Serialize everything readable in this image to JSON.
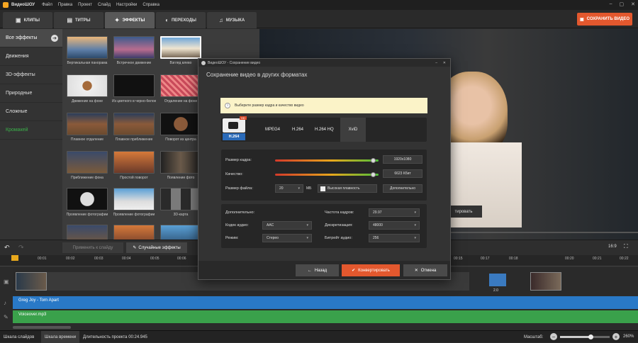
{
  "app": {
    "name": "ВидеоШОУ",
    "menu": [
      "Файл",
      "Правка",
      "Проект",
      "Слайд",
      "Настройки",
      "Справка"
    ]
  },
  "tabs": [
    {
      "label": "КЛИПЫ",
      "icon": "clips-icon"
    },
    {
      "label": "ТИТРЫ",
      "icon": "titles-icon"
    },
    {
      "label": "ЭФФЕКТЫ",
      "icon": "effects-icon"
    },
    {
      "label": "ПЕРЕХОДЫ",
      "icon": "transitions-icon"
    },
    {
      "label": "МУЗЫКА",
      "icon": "music-icon"
    }
  ],
  "save_video_label": "СОХРАНИТЬ ВИДЕО",
  "sidebar": {
    "items": [
      "Все эффекты",
      "Движения",
      "3D-эффекты",
      "Природные",
      "Сложные",
      "Кромакей"
    ]
  },
  "effects": [
    {
      "label": "Вертикальная панорама"
    },
    {
      "label": "Встречное движение"
    },
    {
      "label": "Взгляд влево"
    },
    {
      "label": "Движение на фоне"
    },
    {
      "label": "Из цветного в черно-белое"
    },
    {
      "label": "Отдаление на фоне"
    },
    {
      "label": "Плавное отдаление"
    },
    {
      "label": "Плавное приближение"
    },
    {
      "label": "Поворот из центра"
    },
    {
      "label": "Приближение фона"
    },
    {
      "label": "Простой поворот"
    },
    {
      "label": "Появление фото"
    },
    {
      "label": "Проявление фотографии"
    },
    {
      "label": "Проявление фотографии"
    },
    {
      "label": "3D-карта"
    }
  ],
  "preview": {
    "overlay_button": "тировать",
    "aspect": "16:9"
  },
  "toolbar": {
    "apply_label": "Применить к слайду",
    "random_label": "Случайные эффекты"
  },
  "ruler": {
    "ticks": [
      "00:01",
      "00:02",
      "00:03",
      "00:04",
      "00:05",
      "00:06",
      "00:15",
      "00:17",
      "00:18",
      "00:20",
      "00:21",
      "00:22"
    ]
  },
  "timeline": {
    "clip_duration": "2.0",
    "music_tracks": [
      "Greg Joy - Torn Apart",
      "Voiceover.mp3"
    ]
  },
  "bottom": {
    "tab_slides": "Шкала слайдов",
    "tab_time": "Шкала времени",
    "duration_label": "Длительность проекта 00:24.945",
    "zoom_label": "Масштаб:",
    "zoom_value": "260%",
    "zoom_fraction": 0.62
  },
  "dialog": {
    "window_title": "ВидеоШОУ - Сохранение видео",
    "heading": "Сохранение видео в других форматах",
    "notice": "Выберите размер кадра и качество видео",
    "icon_label": "H.264",
    "icon_badge": "HD",
    "formats": [
      "MPEG4",
      "H.264",
      "H.264 HQ",
      "XviD"
    ],
    "selected_format": "XviD",
    "frame_size_label": "Размер кадра:",
    "frame_size_value": "1920x1080",
    "frame_size_fraction": 0.95,
    "quality_label": "Качество:",
    "quality_value": "6623 Кбит",
    "quality_fraction": 0.95,
    "file_size_label": "Размер файла:",
    "file_size_value": "20",
    "file_size_unit": "МБ",
    "smoothness_label": "Высокая плавность",
    "extra_button": "Дополнительно",
    "advanced_label": "Дополнительно:",
    "audio_codec_label": "Кодек аудио:",
    "audio_codec_value": "AAC",
    "mode_label": "Режим:",
    "mode_value": "Стерео",
    "fps_label": "Частота кадров:",
    "fps_value": "29.97",
    "sampling_label": "Дискретизация:",
    "sampling_value": "48000",
    "audio_bitrate_label": "Битрейт аудио:",
    "audio_bitrate_value": "256",
    "back_label": "Назад",
    "convert_label": "Конвертировать",
    "cancel_label": "Отмена"
  },
  "colors": {
    "accent": "#e3582e",
    "green": "#3bb14a",
    "music_blue": "#2979c7",
    "music_green": "#3aa14b"
  }
}
